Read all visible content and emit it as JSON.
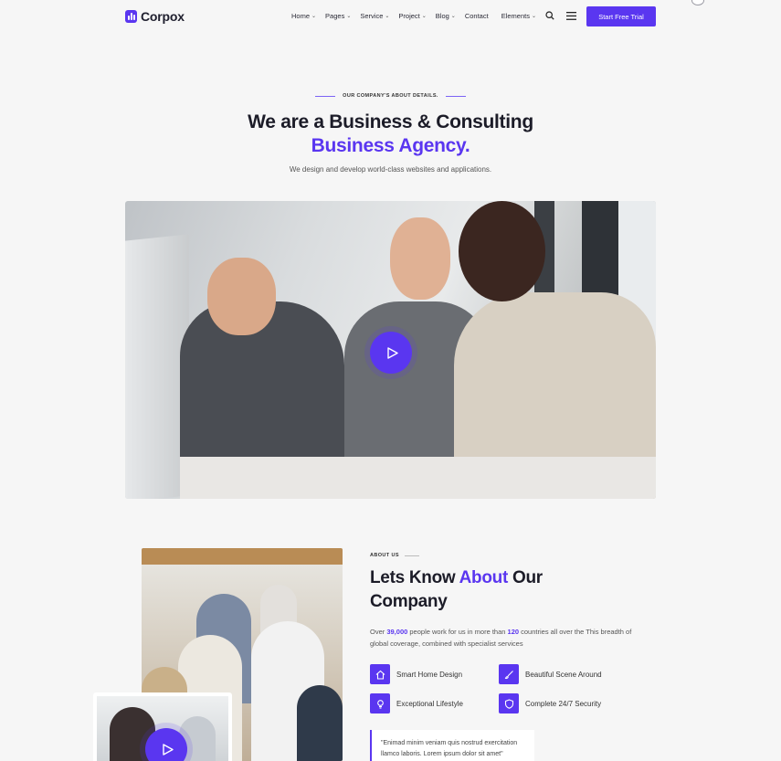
{
  "brand": {
    "name": "Corpox",
    "accent": "#5a36f0"
  },
  "nav": {
    "items": [
      {
        "label": "Home",
        "has_dropdown": true
      },
      {
        "label": "Pages",
        "has_dropdown": true
      },
      {
        "label": "Service",
        "has_dropdown": true
      },
      {
        "label": "Project",
        "has_dropdown": true
      },
      {
        "label": "Blog",
        "has_dropdown": true
      },
      {
        "label": "Contact",
        "has_dropdown": false
      },
      {
        "label": "Elements",
        "has_dropdown": true
      }
    ],
    "search_icon": "search-icon",
    "menu_icon": "hamburger-menu-icon",
    "cta_label": "Start Free Trial"
  },
  "hero": {
    "eyebrow": "OUR COMPANY'S ABOUT DETAILS.",
    "title_line1": "We are a Business & Consulting",
    "title_line2": "Business Agency.",
    "subtitle": "We design and develop world-class websites and applications.",
    "play_icon": "play-icon"
  },
  "about": {
    "eyebrow": "ABOUT US",
    "title_pre": "Lets Know ",
    "title_highlight": "About",
    "title_post": " Our",
    "title_line2": "Company",
    "desc_pre": "Over ",
    "desc_num1": "39,000",
    "desc_mid": " people work for us in more than ",
    "desc_num2": "120",
    "desc_post": " countries all over the This breadth of global coverage, combined with specialist services",
    "features": [
      {
        "label": "Smart Home Design",
        "icon": "home-icon"
      },
      {
        "label": "Beautiful Scene Around",
        "icon": "brush-icon"
      },
      {
        "label": "Exceptional Lifestyle",
        "icon": "bulb-icon"
      },
      {
        "label": "Complete 24/7 Security",
        "icon": "shield-icon"
      }
    ],
    "quote_line1": "\"Enimad minim veniam quis nostrud exercitation",
    "quote_line2": "llamco laboris. Lorem ipsum dolor sit amet\""
  }
}
